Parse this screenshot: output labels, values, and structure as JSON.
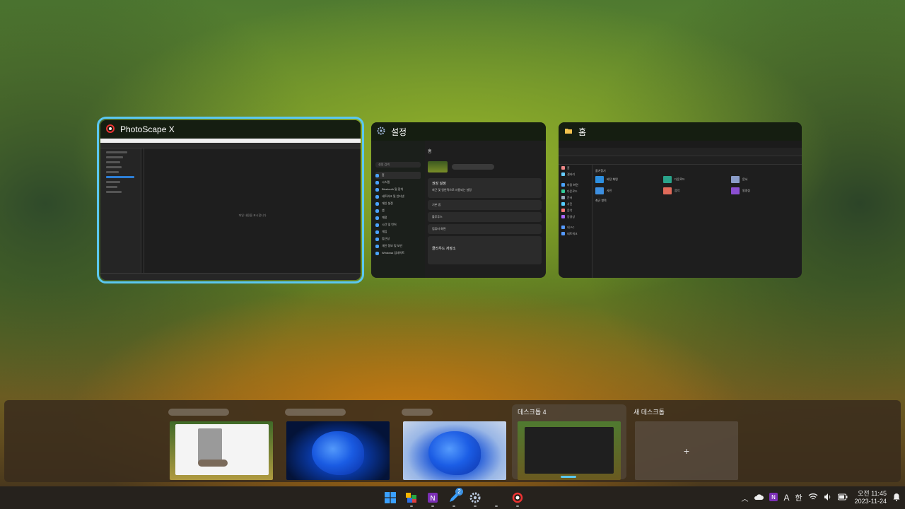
{
  "windows": [
    {
      "title": "PhotoScape X",
      "center_text": "파일 내용을 표시합니다"
    },
    {
      "title": "설정",
      "home": "홈",
      "search": "설정 검색",
      "nav": [
        "홈",
        "시스템",
        "Bluetooth 및 장치",
        "네트워크 및 인터넷",
        "개인 설정",
        "앱",
        "계정",
        "시간 및 언어",
        "게임",
        "접근성",
        "개인 정보 및 보안",
        "Windows 업데이트"
      ],
      "card_title": "권장 설정",
      "card_sub": "최근 및 일반적으로 사용되는 설정",
      "rows": [
        "기본 앱",
        "블루투스",
        "컴퓨터 화면"
      ],
      "cloud_title": "클라우드 저장소"
    },
    {
      "title": "홈",
      "quick": "즐겨찾기",
      "recent": "최근 항목",
      "side": [
        "홈",
        "갤러리",
        "바탕 화면",
        "다운로드",
        "문서",
        "사진",
        "음악",
        "동영상",
        "내 PC",
        "네트워크"
      ],
      "tiles": [
        "바탕 화면",
        "다운로드",
        "문서",
        "사진",
        "음악",
        "동영상"
      ]
    }
  ],
  "desktops": [
    {
      "label": "",
      "redacted": true
    },
    {
      "label": "",
      "redacted": true
    },
    {
      "label": "",
      "redacted": true
    },
    {
      "label": "데스크톱 4",
      "current": true
    },
    {
      "label": "새 데스크톱",
      "plus": "+"
    }
  ],
  "taskbar": {
    "apps": [
      "windows-start",
      "mosaic",
      "onenote",
      "pencil",
      "settings",
      "photoscape"
    ],
    "badge": "2"
  },
  "tray": {
    "ime": "한",
    "time": "오전 11:45",
    "date": "2023-11-24"
  },
  "colors": {
    "accent": "#5bc8f0",
    "onenote": "#7b2fb5",
    "start": "#3aa0ff"
  }
}
